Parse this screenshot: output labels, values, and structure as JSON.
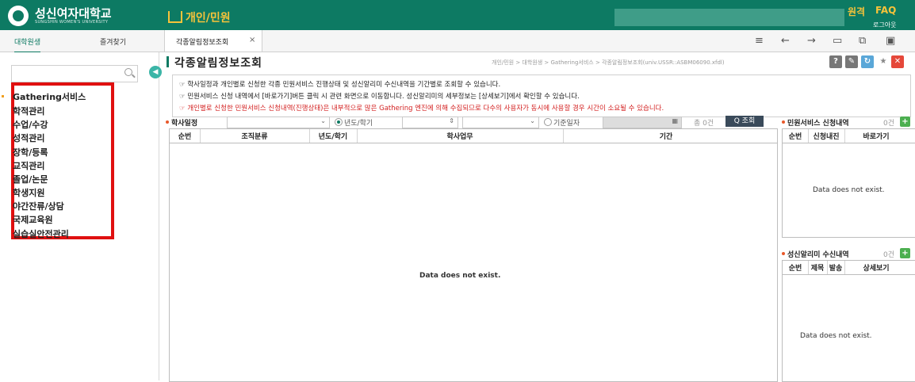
{
  "header": {
    "university_name": "성신여자대학교",
    "university_sub": "SUNGSHIN WOMEN'S UNIVERSITY",
    "menu_title": "개인/민원",
    "links": [
      "원격",
      "FAQ"
    ],
    "logout": "로그아웃"
  },
  "side_tabs": [
    "대학원생",
    "즐겨찾기"
  ],
  "page_tab": {
    "label": "각종알림정보조회",
    "close": "×"
  },
  "sidebar": {
    "items": [
      "Gathering서비스",
      "학적관리",
      "수업/수강",
      "성적관리",
      "장학/등록",
      "교직관리",
      "졸업/논문",
      "학생지원",
      "야간잔류/상담",
      "국제교육원",
      "실습실안전관리"
    ]
  },
  "page": {
    "title": "각종알림정보조회",
    "breadcrumb": "개인/민원 > 대학원생 > Gathering서비스 > 각종알림정보조회(univ.USSR::ASBM06090.xfdl)",
    "help": "?",
    "notices": [
      "☞ 학사일정과 개인별로 신청한 각종 민원서비스 진행상태 및 성신알리미 수신내역을 기간별로 조회할 수 있습니다.",
      "☞ 민원서비스 신청 내역에서 [바로가기]버튼 클릭 시 관련 화면으로 이동합니다. 성신알리미의 세부정보는 [상세보기]에서 확인할 수 있습니다.",
      "☞ 개인별로 신청한 민원서비스 신청내역(진행상태)은 내부적으로 많은 Gathering 엔진에 의해 수집되므로 다수의 사용자가 동시에 사용할 경우 시간이 소요될 수 있습니다."
    ]
  },
  "filter": {
    "label": "학사일정",
    "radio_year": "년도/학기",
    "radio_date": "기준일자",
    "count": "총 0건",
    "search": "Q 조회"
  },
  "main_grid": {
    "columns": [
      "순번",
      "조직분류",
      "년도/학기",
      "학사업무",
      "기간"
    ],
    "empty": "Data does not exist."
  },
  "civil_panel": {
    "title": "민원서비스 신청내역",
    "count": "0건",
    "columns": [
      "순번",
      "신청내진",
      "바로가기"
    ],
    "empty": "Data does not exist."
  },
  "alimi_panel": {
    "title": "성신알리미 수신내역",
    "count": "0건",
    "columns": [
      "순번",
      "제목",
      "발송",
      "상세보기"
    ],
    "empty": "Data does not exist."
  },
  "colors": {
    "brand": "#0d7a63",
    "accent": "#f7c33a",
    "highlight_box": "#e01010",
    "notice_red": "#d31f1f"
  }
}
